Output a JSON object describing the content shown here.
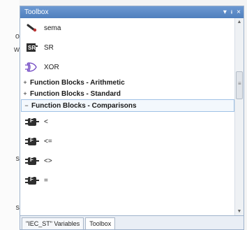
{
  "background_fragments": [
    "o",
    "w",
    "s",
    "s"
  ],
  "toolbox": {
    "title": "Toolbox",
    "controls": {
      "pin": "▾",
      "dock": "ᵼ",
      "close": "×"
    },
    "items": [
      {
        "type": "element",
        "label": "sema",
        "icon": "semaphore-icon"
      },
      {
        "type": "element",
        "label": "SR",
        "icon": "sr-flipflop-icon"
      },
      {
        "type": "element",
        "label": "XOR",
        "icon": "xor-gate-icon"
      },
      {
        "type": "category",
        "label": "Function Blocks - Arithmetic",
        "expander": "+"
      },
      {
        "type": "category",
        "label": "Function Blocks - Standard",
        "expander": "+"
      },
      {
        "type": "category",
        "label": "Function Blocks - Comparisons",
        "expander": "−",
        "selected": true
      },
      {
        "type": "element",
        "label": "<",
        "icon": "function-block-icon"
      },
      {
        "type": "element",
        "label": "<=",
        "icon": "function-block-icon"
      },
      {
        "type": "element",
        "label": "<>",
        "icon": "function-block-icon"
      },
      {
        "type": "element",
        "label": "=",
        "icon": "function-block-icon"
      }
    ]
  },
  "tabs": [
    {
      "label": "\"IEC_ST\" Variables",
      "active": false
    },
    {
      "label": "Toolbox",
      "active": true
    }
  ],
  "colors": {
    "titlebar": "#5a8ac8",
    "border": "#9fb3cc",
    "selected_border": "#9fc2e6"
  }
}
